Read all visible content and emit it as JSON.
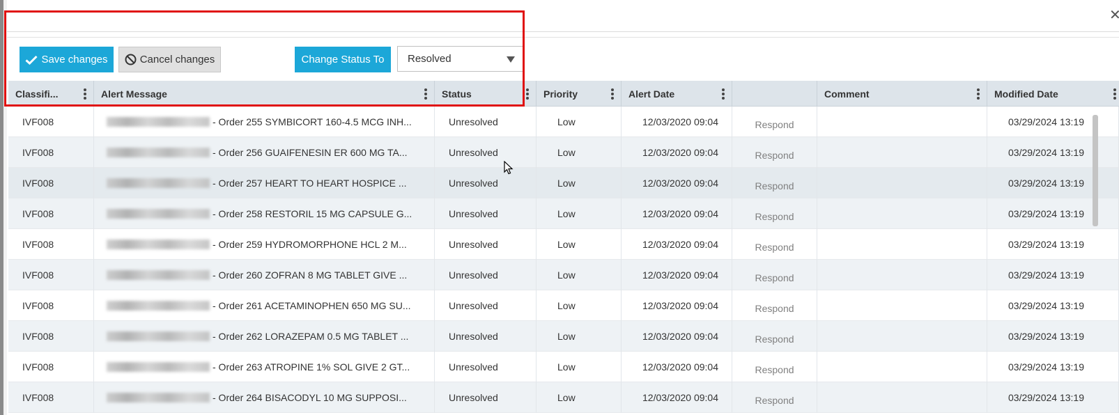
{
  "toolbar": {
    "save_label": "Save changes",
    "cancel_label": "Cancel changes",
    "change_status_label": "Change Status To",
    "status_select_value": "Resolved"
  },
  "columns": [
    {
      "label": "Classifi..."
    },
    {
      "label": "Alert Message"
    },
    {
      "label": "Status"
    },
    {
      "label": "Priority"
    },
    {
      "label": "Alert Date"
    },
    {
      "label": ""
    },
    {
      "label": "Comment"
    },
    {
      "label": "Modified Date"
    }
  ],
  "rows": [
    {
      "classification": "IVF008",
      "message": "- Order 255 SYMBICORT 160-4.5 MCG INH...",
      "status": "Unresolved",
      "priority": "Low",
      "alert_date": "12/03/2020 09:04",
      "action": "Respond",
      "comment": "",
      "modified_date": "03/29/2024 13:19"
    },
    {
      "classification": "IVF008",
      "message": "- Order 256 GUAIFENESIN ER 600 MG TA...",
      "status": "Unresolved",
      "priority": "Low",
      "alert_date": "12/03/2020 09:04",
      "action": "Respond",
      "comment": "",
      "modified_date": "03/29/2024 13:19"
    },
    {
      "classification": "IVF008",
      "message": "- Order 257 HEART TO HEART HOSPICE ...",
      "status": "Unresolved",
      "priority": "Low",
      "alert_date": "12/03/2020 09:04",
      "action": "Respond",
      "comment": "",
      "modified_date": "03/29/2024 13:19"
    },
    {
      "classification": "IVF008",
      "message": "- Order 258 RESTORIL 15 MG CAPSULE G...",
      "status": "Unresolved",
      "priority": "Low",
      "alert_date": "12/03/2020 09:04",
      "action": "Respond",
      "comment": "",
      "modified_date": "03/29/2024 13:19"
    },
    {
      "classification": "IVF008",
      "message": "- Order 259 HYDROMORPHONE HCL 2 M...",
      "status": "Unresolved",
      "priority": "Low",
      "alert_date": "12/03/2020 09:04",
      "action": "Respond",
      "comment": "",
      "modified_date": "03/29/2024 13:19"
    },
    {
      "classification": "IVF008",
      "message": "- Order 260 ZOFRAN 8 MG TABLET GIVE ...",
      "status": "Unresolved",
      "priority": "Low",
      "alert_date": "12/03/2020 09:04",
      "action": "Respond",
      "comment": "",
      "modified_date": "03/29/2024 13:19"
    },
    {
      "classification": "IVF008",
      "message": "- Order 261 ACETAMINOPHEN 650 MG SU...",
      "status": "Unresolved",
      "priority": "Low",
      "alert_date": "12/03/2020 09:04",
      "action": "Respond",
      "comment": "",
      "modified_date": "03/29/2024 13:19"
    },
    {
      "classification": "IVF008",
      "message": "- Order 262 LORAZEPAM 0.5 MG TABLET ...",
      "status": "Unresolved",
      "priority": "Low",
      "alert_date": "12/03/2020 09:04",
      "action": "Respond",
      "comment": "",
      "modified_date": "03/29/2024 13:19"
    },
    {
      "classification": "IVF008",
      "message": "- Order 263 ATROPINE 1% SOL GIVE 2 GT...",
      "status": "Unresolved",
      "priority": "Low",
      "alert_date": "12/03/2020 09:04",
      "action": "Respond",
      "comment": "",
      "modified_date": "03/29/2024 13:19"
    },
    {
      "classification": "IVF008",
      "message": "- Order 264 BISACODYL 10 MG SUPPOSI...",
      "status": "Unresolved",
      "priority": "Low",
      "alert_date": "12/03/2020 09:04",
      "action": "Respond",
      "comment": "",
      "modified_date": "03/29/2024 13:19"
    }
  ],
  "colors": {
    "accent": "#1ca7d8",
    "header_bg": "#dde4ea",
    "alt_row_bg": "#eef2f5",
    "highlight_border": "#e01010"
  },
  "icons": {
    "save": "checkmark-icon",
    "cancel": "prohibited-icon",
    "column_menu": "kebab-icon",
    "close": "close-icon",
    "dropdown": "caret-down-icon"
  }
}
